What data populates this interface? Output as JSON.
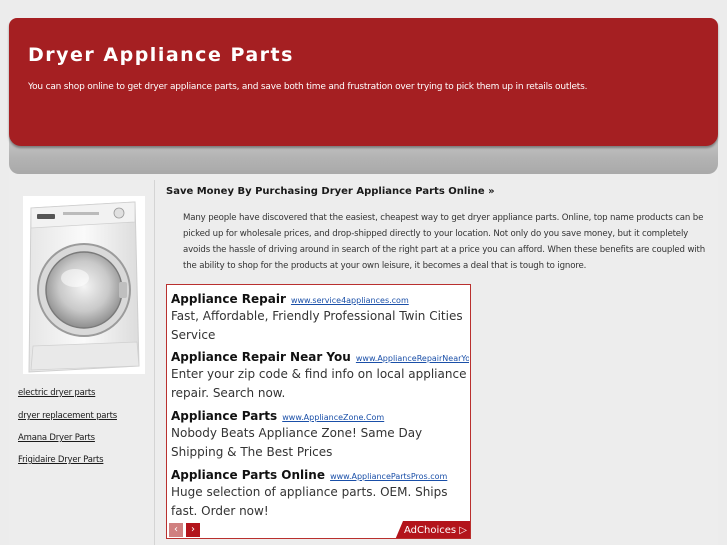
{
  "header": {
    "title": "Dryer Appliance Parts",
    "description": "You can shop online to get dryer appliance parts, and save both time and frustration over trying to pick them up in retails outlets."
  },
  "sidebar": {
    "image_icon": "front-load-washer-image",
    "links": [
      "electric dryer parts",
      "dryer replacement parts",
      "Amana Dryer Parts",
      "Frigidaire Dryer Parts"
    ]
  },
  "post": {
    "title": "Save Money By Purchasing Dryer Appliance Parts Online »",
    "body": "Many people have discovered that the easiest, cheapest way to get dryer appliance parts. Online, top name products can be picked up for wholesale prices, and drop-shipped directly to your location. Not only do you save money, but it completely avoids the hassle of driving around in search of the right part at a price you can afford. When these benefits are coupled with the ability to shop for the products at your own leisure, it becomes a deal that is tough to ignore."
  },
  "ads": [
    {
      "title": "Appliance Repair",
      "url": "www.service4appliances.com",
      "text": "Fast, Affordable, Friendly Professional Twin Cities Service"
    },
    {
      "title": "Appliance Repair Near You",
      "url": "www.ApplianceRepairNearYou",
      "text": "Enter your zip code & find info on local appliance repair. Search now."
    },
    {
      "title": "Appliance Parts",
      "url": "www.ApplianceZone.Com",
      "text": "Nobody Beats Appliance Zone! Same Day Shipping & The Best Prices"
    },
    {
      "title": "Appliance Parts Online",
      "url": "www.AppliancePartsPros.com",
      "text": "Huge selection of appliance parts. OEM. Ships fast. Order now!"
    }
  ],
  "ad_controls": {
    "prev": "‹",
    "next": "›",
    "adchoices": "AdChoices ▷"
  },
  "colors": {
    "header_red": "#a51f22",
    "ad_border": "#b9302e",
    "link_blue": "#1a4fa8"
  }
}
